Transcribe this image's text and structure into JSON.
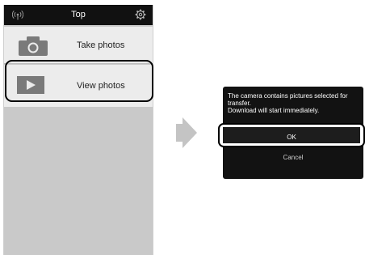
{
  "phone": {
    "header": {
      "title": "Top",
      "left_icon": "wifi-signal-icon",
      "right_icon": "gear-icon"
    },
    "menu": [
      {
        "label": "Take photos",
        "icon": "camera-icon"
      },
      {
        "label": "View photos",
        "icon": "play-icon"
      }
    ]
  },
  "arrow_icon": "next-arrow-icon",
  "dialog": {
    "message_line1": "The camera contains pictures selected for transfer.",
    "message_line2": "Download will start immediately.",
    "ok_label": "OK",
    "cancel_label": "Cancel"
  },
  "colors": {
    "header": "#111111",
    "menu_item": "#ececec",
    "phone_background": "#c9c9c9",
    "dialog": "#121212",
    "highlight": "#000000"
  }
}
